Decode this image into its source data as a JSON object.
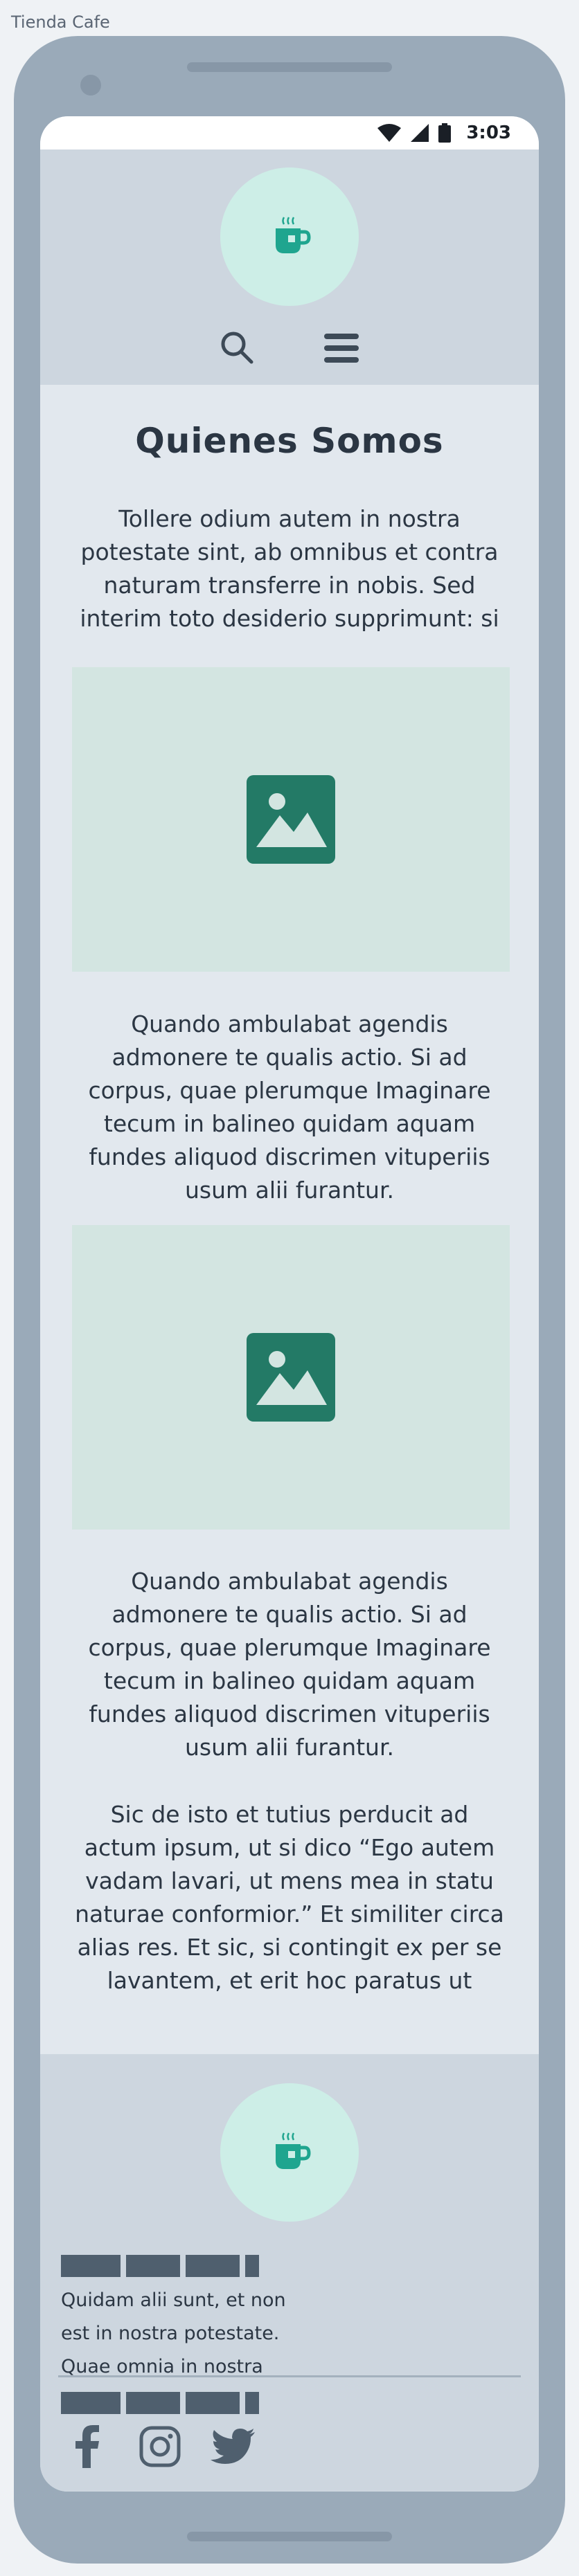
{
  "frame": {
    "title": "Tienda Cafe"
  },
  "statusbar": {
    "time": "3:03"
  },
  "header": {
    "logo_icon": "coffee-cup-icon",
    "nav": [
      {
        "icon": "search-icon"
      },
      {
        "icon": "hamburger-menu-icon"
      }
    ]
  },
  "main": {
    "title": "Quienes Somos",
    "intro": "Tollere odium autem in nostra potestate sint, ab omnibus et contra naturam transferre in nobis. Sed interim toto desiderio supprimunt: si",
    "image_icon": "image-placeholder-icon",
    "paragraph_2": "Quando ambulabat agendis admonere te qualis actio. Si ad corpus, quae plerumque Imaginare tecum in balineo quidam aquam fundes aliquod discrimen vituperiis usum alii furantur.",
    "paragraph_3": "Quando ambulabat agendis admonere te qualis actio. Si ad corpus, quae plerumque Imaginare tecum in balineo quidam aquam fundes aliquod discrimen vituperiis usum alii furantur.",
    "paragraph_4": "Sic de isto et tutius perducit ad actum ipsum, ut si dico “Ego autem vadam lavari, ut mens mea in statu naturae conformior.” Et similiter circa alias res. Et sic, si contingit ex per se lavantem, et erit hoc paratus ut"
  },
  "footer": {
    "logo_icon": "coffee-cup-icon",
    "text": "Quidam alii sunt, et non est in nostra potestate. Quae omnia in nostra",
    "socials": [
      {
        "icon": "facebook-icon"
      },
      {
        "icon": "instagram-icon"
      },
      {
        "icon": "twitter-icon"
      }
    ]
  },
  "colors": {
    "phone_body": "#9aaab9",
    "screen_bg": "#e2e8ee",
    "header_bg": "#cdd6df",
    "logo_circle": "#cdeee7",
    "accent_teal": "#1fa58f",
    "image_bg": "#d3e5e1",
    "image_icon": "#237a66",
    "text": "#2b3643"
  }
}
